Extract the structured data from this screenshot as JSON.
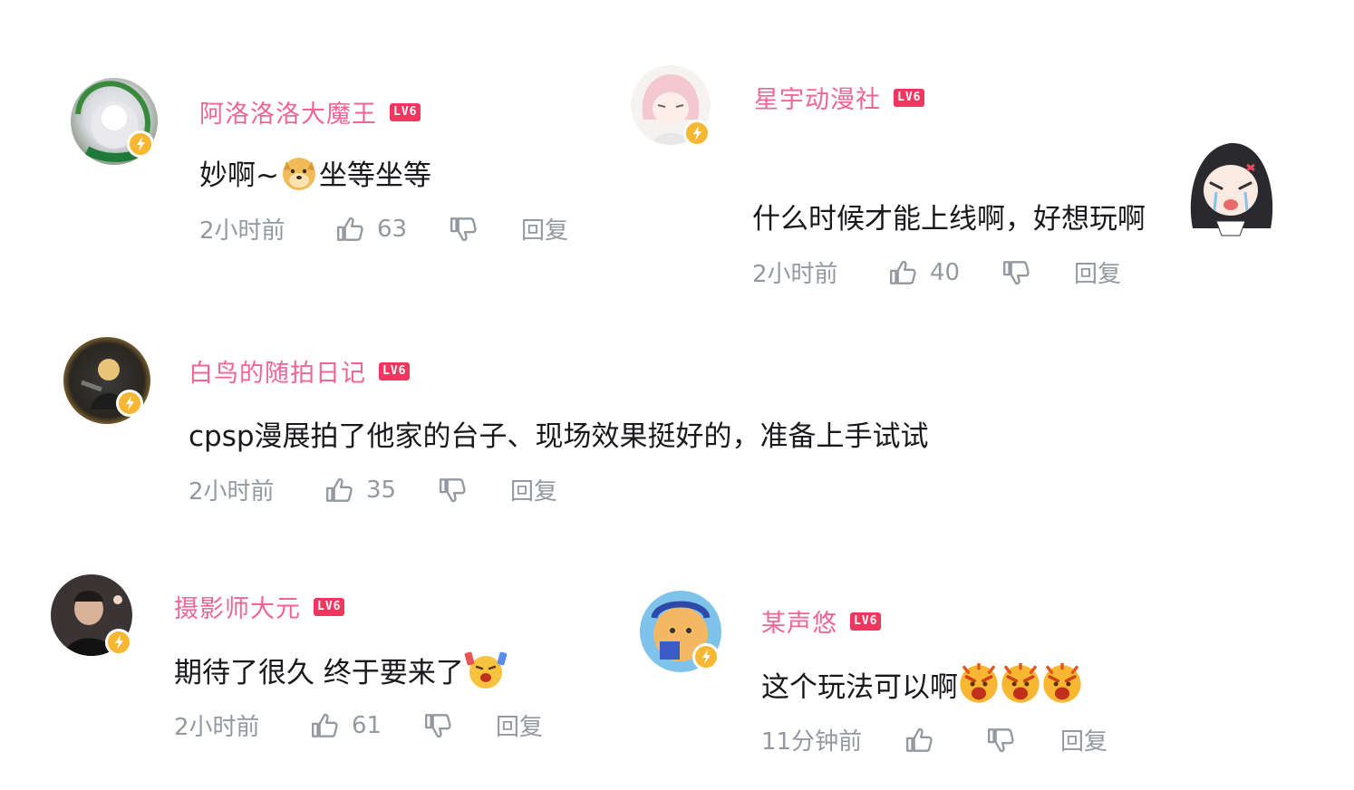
{
  "comments": [
    {
      "username": "阿洛洛洛大魔王",
      "level": "LV6",
      "text": "妙啊~",
      "text_after_emoji": "坐等坐等",
      "time": "2小时前",
      "likes": "63",
      "reply": "回复",
      "emoji": "doge-emoji"
    },
    {
      "username": "星宇动漫社",
      "level": "LV6",
      "text": "什么时候才能上线啊，好想玩啊",
      "time": "2小时前",
      "likes": "40",
      "reply": "回复",
      "emoji": "anime-girl-crying-sticker"
    },
    {
      "username": "白鸟的随拍日记",
      "level": "LV6",
      "text": "cpsp漫展拍了他家的台子、现场效果挺好的，准备上手试试",
      "time": "2小时前",
      "likes": "35",
      "reply": "回复"
    },
    {
      "username": "摄影师大元",
      "level": "LV6",
      "text": "期待了很久 终于要来了",
      "time": "2小时前",
      "likes": "61",
      "reply": "回复",
      "emoji": "cheering-emoji"
    },
    {
      "username": "某声悠",
      "level": "LV6",
      "text": "这个玩法可以啊",
      "time": "11分钟前",
      "likes": "",
      "reply": "回复",
      "emoji": "angry-emoji"
    }
  ],
  "colors": {
    "username": "#f06592",
    "level_badge": "#f3365f",
    "meta_text": "#9499a0",
    "bolt_badge": "#f6b733"
  }
}
